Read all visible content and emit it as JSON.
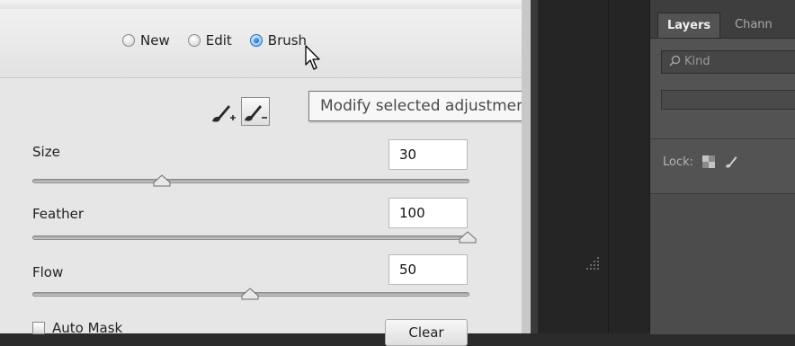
{
  "mode_bar": {
    "options": [
      {
        "label": "New",
        "checked": false
      },
      {
        "label": "Edit",
        "checked": false
      },
      {
        "label": "Brush",
        "checked": true
      }
    ]
  },
  "tooltip": {
    "text": "Modify selected adjustment using brush (Shift-K)"
  },
  "params": [
    {
      "label": "Size",
      "value": "30",
      "slider_fraction": 0.3
    },
    {
      "label": "Feather",
      "value": "100",
      "slider_fraction": 1.0
    },
    {
      "label": "Flow",
      "value": "50",
      "slider_fraction": 0.5
    }
  ],
  "automask": {
    "label": "Auto Mask"
  },
  "clear_button": {
    "label": "Clear"
  },
  "layers_panel": {
    "tabs": [
      {
        "label": "Layers",
        "active": true
      },
      {
        "label": "Chann",
        "active": false
      }
    ],
    "kind_filter": {
      "label": "Kind"
    },
    "lock_label": "Lock:"
  },
  "colors": {
    "dialog_bg": "#e6e6e6",
    "panel_bg": "#535353",
    "radio_selected": "#2a6fb0"
  }
}
